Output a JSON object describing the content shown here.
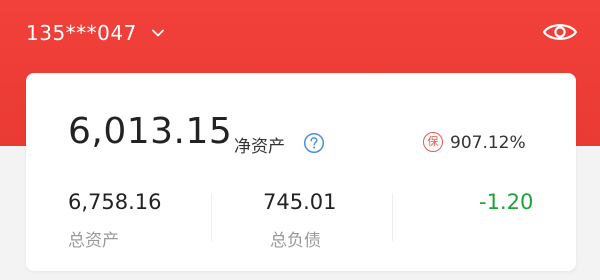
{
  "account": {
    "masked_number": "135***047",
    "chevron_icon": "chevron-down-icon"
  },
  "header": {
    "visibility_icon": "eye-icon",
    "background_color": "#ee3d36"
  },
  "summary": {
    "net_assets_value": "6,013.15",
    "net_assets_label": "净资产",
    "help_icon": "question-circle-icon",
    "guarantee_badge": "保",
    "guarantee_ratio": "907.12%",
    "total_assets_value": "6,758.16",
    "total_assets_label": "总资产",
    "total_liabilities_value": "745.01",
    "total_liabilities_label": "总负债",
    "change_value": "-1.20",
    "change_color": "#1fa33a"
  }
}
